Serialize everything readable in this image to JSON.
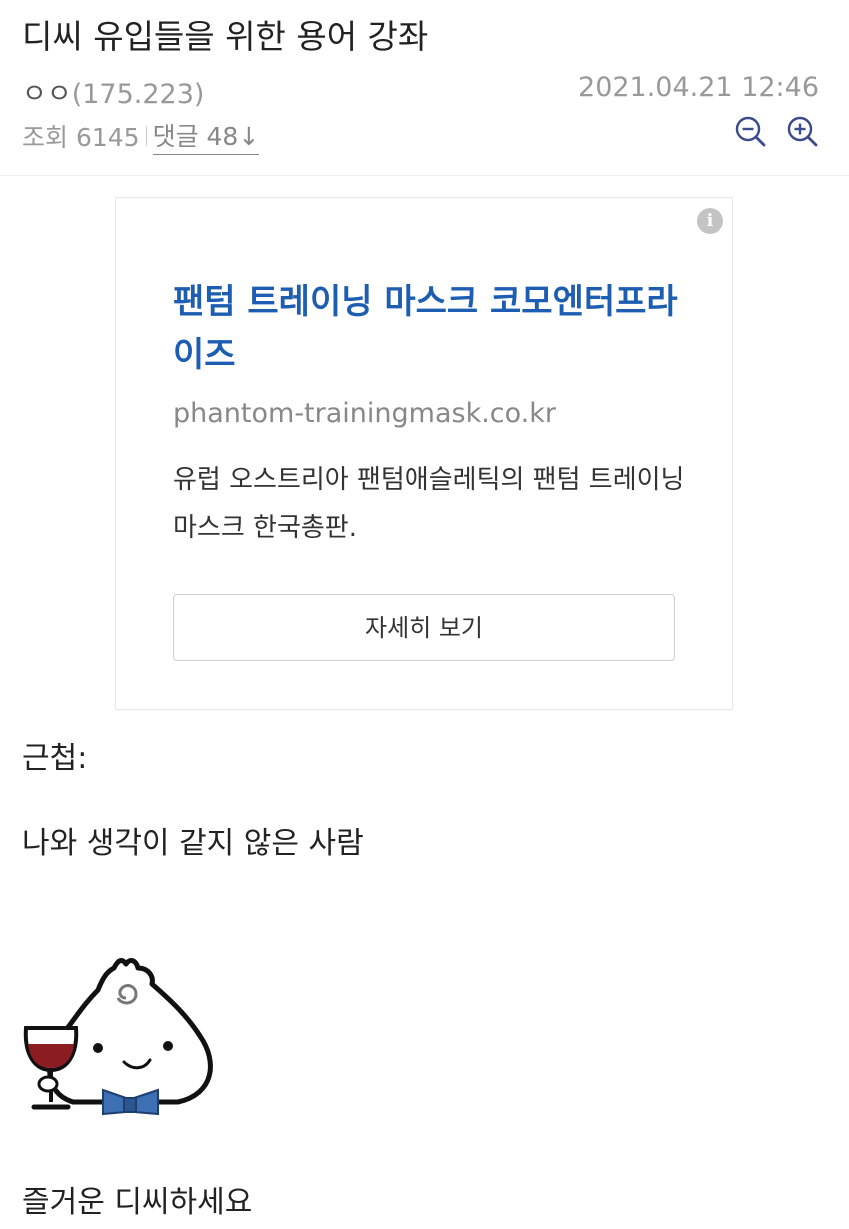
{
  "post": {
    "title": "디씨 유입들을 위한 용어 강좌",
    "author_name": "ㅇㅇ",
    "author_ip": "(175.223)",
    "date": "2021.04.21 12:46",
    "views_label": "조회 6145",
    "comments_label": "댓글 48↓"
  },
  "toolbar": {
    "zoom_out_icon": "zoom-out-icon",
    "zoom_in_icon": "zoom-in-icon"
  },
  "ad": {
    "headline": "팬텀 트레이닝 마스크 코모엔터프라이즈",
    "url": "phantom-trainingmask.co.kr",
    "description": "유럽 오스트리아 팬텀애슬레틱의 팬텀 트레이닝 마스크 한국총판.",
    "button_label": "자세히 보기",
    "info_glyph": "i",
    "accent_color": "#1d5db2"
  },
  "content": {
    "line1": "근첩:",
    "line2": "나와 생각이 같지 않은 사람",
    "line3": "즐거운 디씨하세요"
  }
}
